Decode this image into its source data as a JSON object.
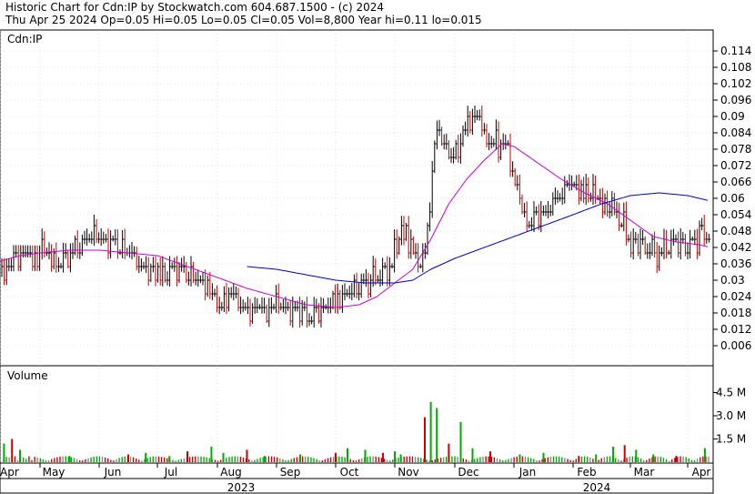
{
  "header": {
    "line1": "Historic Chart for Cdn:IP by Stockwatch.com 604.687.1500 - (c) 2024",
    "line2": "Thu Apr 25 2024  Op=0.05  Hi=0.05  Lo=0.05  Cl=0.05  Vol=8,800  Year hi=0.11  lo=0.015"
  },
  "price_panel_label": "Cdn:IP",
  "volume_panel_label": "Volume",
  "colors": {
    "up": "#000000",
    "down": "#cc0000",
    "ma_short": "#cc00cc",
    "ma_long": "#0000cc",
    "vol_up": "#00aa00",
    "vol_down": "#cc0000",
    "vol_flat": "#888888",
    "grid": "#c8c8c8"
  },
  "chart_data": {
    "type": "line",
    "title": "Historic Chart for Cdn:IP",
    "price_ticks": [
      "0.114",
      "0.108",
      "0.102",
      "0.096",
      "0.09",
      "0.084",
      "0.078",
      "0.072",
      "0.066",
      "0.06",
      "0.054",
      "0.048",
      "0.042",
      "0.036",
      "0.03",
      "0.024",
      "0.018",
      "0.012",
      "0.006"
    ],
    "volume_ticks": [
      "4.5 M",
      "3.0 M",
      "1.5 M"
    ],
    "months": [
      {
        "label": "Apr",
        "t": 0.0
      },
      {
        "label": "May",
        "t": 1.0
      },
      {
        "label": "Jun",
        "t": 2.0
      },
      {
        "label": "Jul",
        "t": 3.0
      },
      {
        "label": "Aug",
        "t": 4.0
      },
      {
        "label": "Sep",
        "t": 5.0
      },
      {
        "label": "Oct",
        "t": 6.0
      },
      {
        "label": "Nov",
        "t": 7.0
      },
      {
        "label": "Dec",
        "t": 8.0
      },
      {
        "label": "Jan",
        "t": 9.0
      },
      {
        "label": "Feb",
        "t": 10.0
      },
      {
        "label": "Mar",
        "t": 11.0
      },
      {
        "label": "Apr",
        "t": 12.0
      }
    ],
    "years": [
      {
        "label": "2023",
        "t": 4.0
      },
      {
        "label": "2024",
        "t": 10.0
      }
    ],
    "close_keypoints": [
      [
        0.0,
        0.033
      ],
      [
        0.3,
        0.036
      ],
      [
        0.6,
        0.042
      ],
      [
        0.9,
        0.036
      ],
      [
        1.0,
        0.042
      ],
      [
        1.3,
        0.036
      ],
      [
        1.6,
        0.042
      ],
      [
        1.9,
        0.046
      ],
      [
        2.3,
        0.042
      ],
      [
        2.6,
        0.038
      ],
      [
        3.0,
        0.033
      ],
      [
        3.4,
        0.033
      ],
      [
        3.7,
        0.03
      ],
      [
        3.9,
        0.026
      ],
      [
        4.0,
        0.022
      ],
      [
        4.2,
        0.024
      ],
      [
        4.5,
        0.02
      ],
      [
        4.8,
        0.018
      ],
      [
        5.0,
        0.022
      ],
      [
        5.3,
        0.018
      ],
      [
        5.6,
        0.017
      ],
      [
        5.9,
        0.021
      ],
      [
        6.1,
        0.024
      ],
      [
        6.3,
        0.026
      ],
      [
        6.6,
        0.03
      ],
      [
        6.9,
        0.034
      ],
      [
        7.0,
        0.04
      ],
      [
        7.1,
        0.048
      ],
      [
        7.2,
        0.046
      ],
      [
        7.4,
        0.036
      ],
      [
        7.5,
        0.04
      ],
      [
        7.6,
        0.062
      ],
      [
        7.7,
        0.085
      ],
      [
        7.8,
        0.08
      ],
      [
        8.0,
        0.076
      ],
      [
        8.2,
        0.088
      ],
      [
        8.4,
        0.092
      ],
      [
        8.5,
        0.083
      ],
      [
        8.7,
        0.08
      ],
      [
        8.9,
        0.078
      ],
      [
        9.0,
        0.068
      ],
      [
        9.1,
        0.06
      ],
      [
        9.2,
        0.052
      ],
      [
        9.5,
        0.054
      ],
      [
        9.7,
        0.058
      ],
      [
        9.9,
        0.066
      ],
      [
        10.1,
        0.062
      ],
      [
        10.3,
        0.062
      ],
      [
        10.5,
        0.058
      ],
      [
        10.7,
        0.056
      ],
      [
        10.9,
        0.05
      ],
      [
        11.0,
        0.042
      ],
      [
        11.3,
        0.042
      ],
      [
        11.5,
        0.038
      ],
      [
        11.6,
        0.042
      ],
      [
        11.8,
        0.044
      ],
      [
        12.0,
        0.042
      ],
      [
        12.2,
        0.046
      ],
      [
        12.4,
        0.048
      ]
    ],
    "ma_short_keypoints": [
      [
        0.0,
        0.037
      ],
      [
        0.5,
        0.039
      ],
      [
        1.0,
        0.04
      ],
      [
        1.5,
        0.041
      ],
      [
        2.0,
        0.041
      ],
      [
        2.5,
        0.04
      ],
      [
        3.0,
        0.039
      ],
      [
        3.5,
        0.035
      ],
      [
        4.0,
        0.031
      ],
      [
        4.5,
        0.027
      ],
      [
        5.0,
        0.024
      ],
      [
        5.5,
        0.021
      ],
      [
        6.0,
        0.02
      ],
      [
        6.4,
        0.021
      ],
      [
        6.7,
        0.024
      ],
      [
        7.0,
        0.029
      ],
      [
        7.3,
        0.034
      ],
      [
        7.6,
        0.045
      ],
      [
        7.9,
        0.058
      ],
      [
        8.2,
        0.067
      ],
      [
        8.5,
        0.074
      ],
      [
        8.8,
        0.08
      ],
      [
        9.0,
        0.079
      ],
      [
        9.4,
        0.073
      ],
      [
        9.8,
        0.067
      ],
      [
        10.2,
        0.062
      ],
      [
        10.6,
        0.058
      ],
      [
        11.0,
        0.052
      ],
      [
        11.4,
        0.046
      ],
      [
        11.8,
        0.044
      ],
      [
        12.2,
        0.043
      ],
      [
        12.4,
        0.042
      ]
    ],
    "ma_long_keypoints": [
      [
        4.5,
        0.035
      ],
      [
        5.0,
        0.034
      ],
      [
        5.5,
        0.032
      ],
      [
        6.0,
        0.03
      ],
      [
        6.5,
        0.029
      ],
      [
        7.0,
        0.029
      ],
      [
        7.3,
        0.03
      ],
      [
        7.6,
        0.034
      ],
      [
        8.0,
        0.038
      ],
      [
        8.5,
        0.042
      ],
      [
        9.0,
        0.046
      ],
      [
        9.5,
        0.05
      ],
      [
        10.0,
        0.054
      ],
      [
        10.5,
        0.058
      ],
      [
        11.0,
        0.061
      ],
      [
        11.5,
        0.062
      ],
      [
        12.0,
        0.061
      ],
      [
        12.4,
        0.059
      ]
    ],
    "volume_spikes_M": [
      [
        0.1,
        1.2
      ],
      [
        0.3,
        1.5
      ],
      [
        0.5,
        0.8
      ],
      [
        1.5,
        0.4
      ],
      [
        2.5,
        0.5
      ],
      [
        2.8,
        0.6
      ],
      [
        3.2,
        0.4
      ],
      [
        3.5,
        0.7
      ],
      [
        3.9,
        1.0
      ],
      [
        4.1,
        0.6
      ],
      [
        4.5,
        0.8
      ],
      [
        4.8,
        0.4
      ],
      [
        5.4,
        0.5
      ],
      [
        6.0,
        0.6
      ],
      [
        6.2,
        0.9
      ],
      [
        6.5,
        0.8
      ],
      [
        6.8,
        0.6
      ],
      [
        7.0,
        0.7
      ],
      [
        7.1,
        0.5
      ],
      [
        7.5,
        2.9
      ],
      [
        7.6,
        3.9
      ],
      [
        7.7,
        3.5
      ],
      [
        7.9,
        1.2
      ],
      [
        8.1,
        2.6
      ],
      [
        8.3,
        0.9
      ],
      [
        8.6,
        0.7
      ],
      [
        9.1,
        0.5
      ],
      [
        9.5,
        0.6
      ],
      [
        10.1,
        0.4
      ],
      [
        10.4,
        0.5
      ],
      [
        10.7,
        1.0
      ],
      [
        10.9,
        1.1
      ],
      [
        11.1,
        0.8
      ],
      [
        11.4,
        0.5
      ],
      [
        11.8,
        0.4
      ],
      [
        12.3,
        0.9
      ]
    ]
  }
}
